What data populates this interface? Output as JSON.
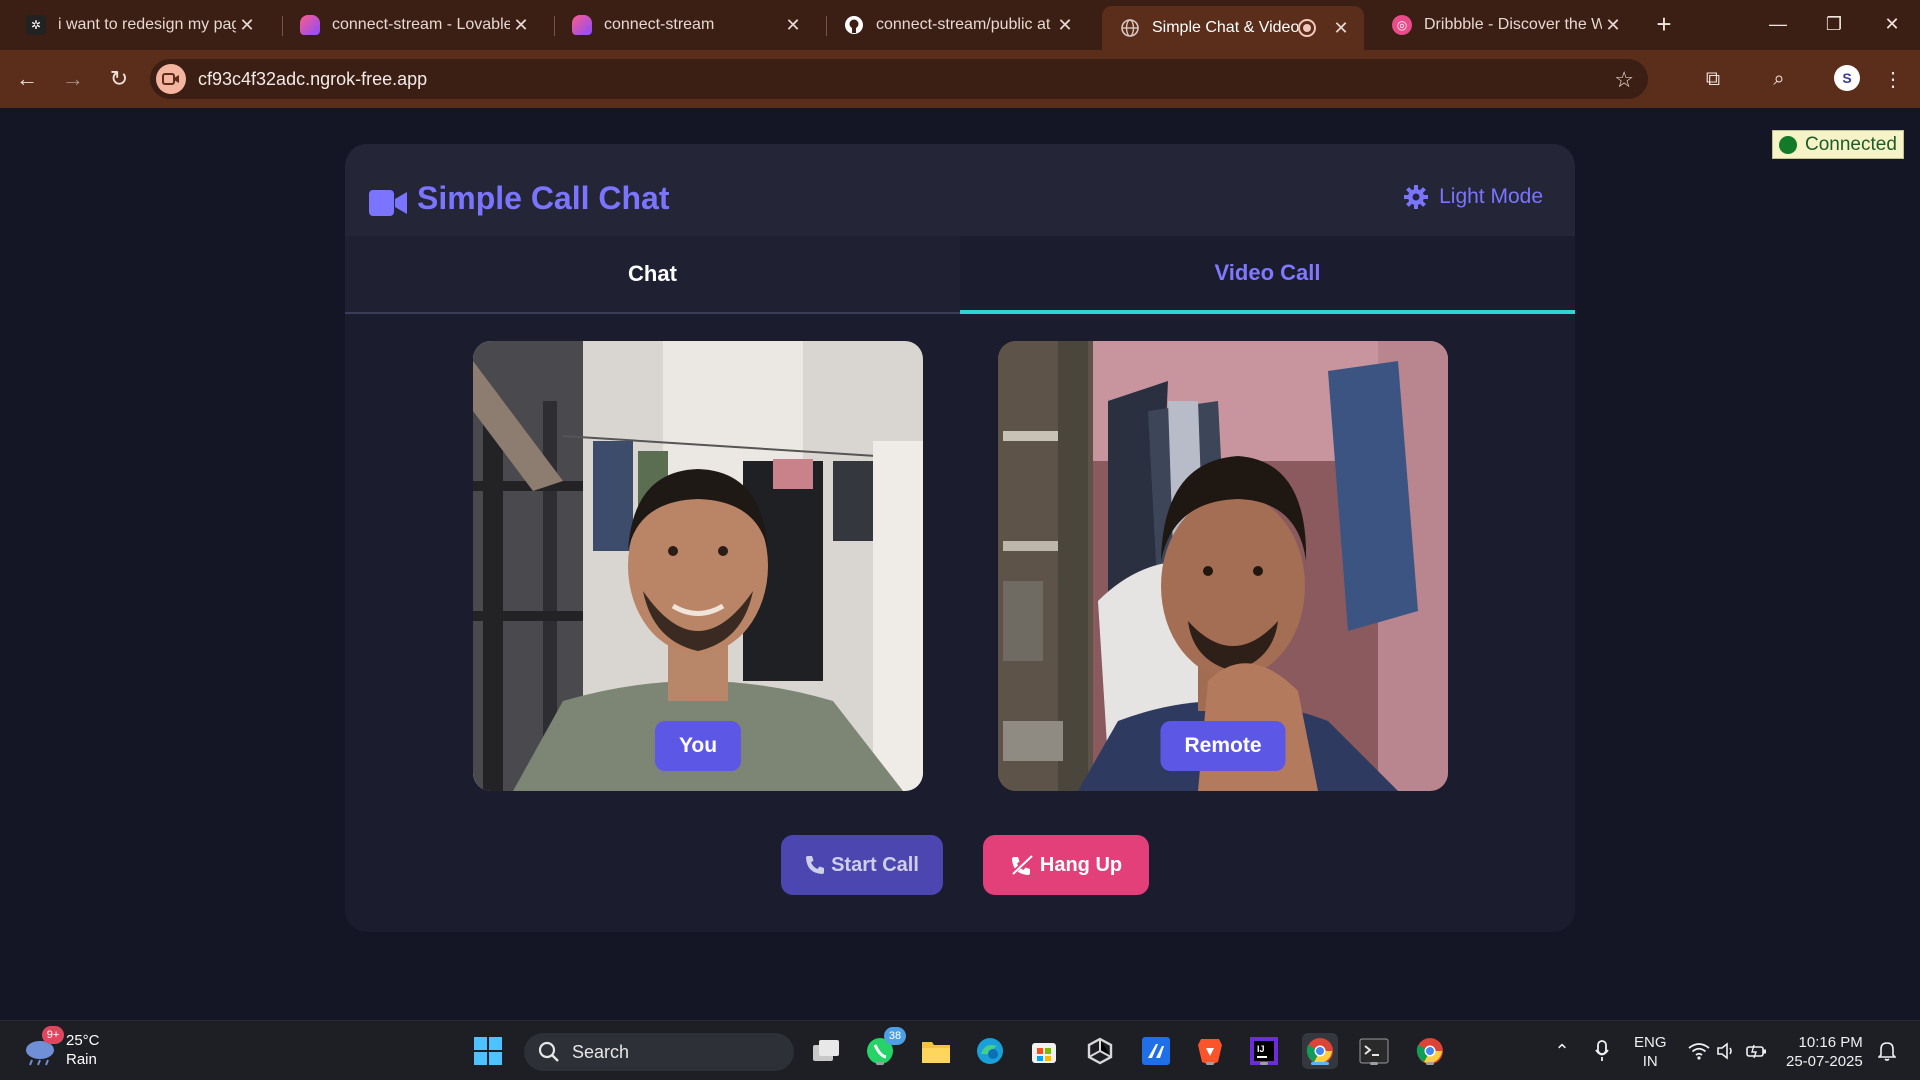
{
  "browser": {
    "tabs": [
      {
        "title": "i want to redesign my page"
      },
      {
        "title": "connect-stream - Lovable"
      },
      {
        "title": "connect-stream"
      },
      {
        "title": "connect-stream/public at m"
      },
      {
        "title": "Simple Chat & Video",
        "active": true
      },
      {
        "title": "Dribbble - Discover the Wo"
      }
    ],
    "url": "cf93c4f32adc.ngrok-free.app"
  },
  "status": {
    "connection": "Connected",
    "color": "#137a2a"
  },
  "app": {
    "title": "Simple Call Chat",
    "theme_toggle": "Light Mode",
    "tabs": [
      {
        "label": "Chat",
        "active": false
      },
      {
        "label": "Video Call",
        "active": true
      }
    ],
    "videos": {
      "local_label": "You",
      "remote_label": "Remote"
    },
    "buttons": {
      "start_call": "Start Call",
      "hang_up": "Hang Up"
    },
    "colors": {
      "accent": "#7b74ff",
      "tab_indicator": "#2ed3d3",
      "hang_up": "#e33f79",
      "start_call": "#4b46b0"
    }
  },
  "taskbar": {
    "weather": {
      "temp": "25°C",
      "condition": "Rain",
      "badge": "9+"
    },
    "search_placeholder": "Search",
    "whatsapp_badge": "38",
    "language": {
      "line1": "ENG",
      "line2": "IN"
    },
    "clock": {
      "time": "10:16 PM",
      "date": "25-07-2025"
    }
  }
}
